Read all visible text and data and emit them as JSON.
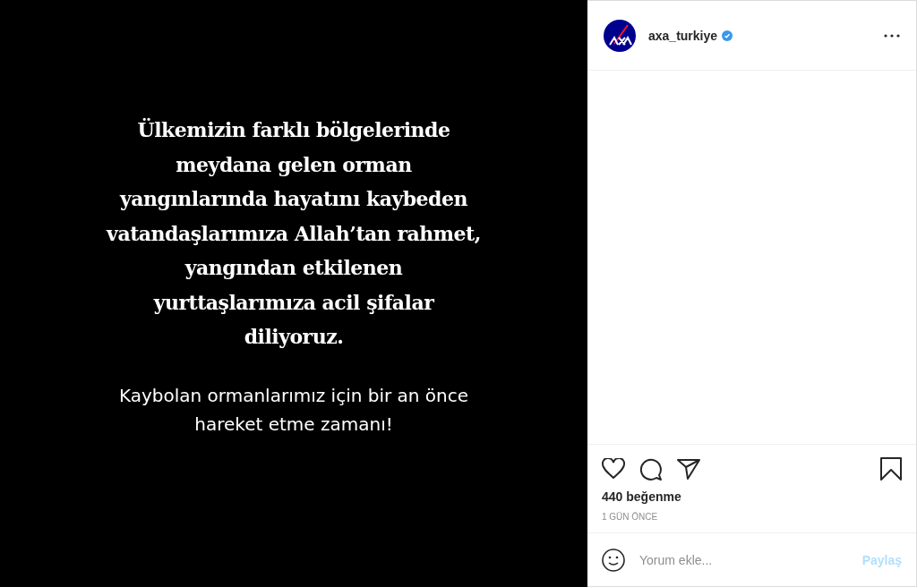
{
  "post_image": {
    "headline_lines": [
      "Ülkemizin farklı bölgelerinde",
      "meydana gelen orman",
      "yangınlarında hayatını kaybeden",
      "vatandaşlarımıza Allah’tan rahmet,",
      "yangından etkilenen",
      "yurttaşlarımıza acil şifalar",
      "diliyoruz."
    ],
    "subline_lines": [
      "Kaybolan ormanlarımız için bir an önce",
      "hareket etme zamanı!"
    ]
  },
  "header": {
    "username": "axa_turkiye",
    "verified": true
  },
  "likes": "440 beğenme",
  "time": "1 GÜN ÖNCE",
  "comment": {
    "placeholder": "Yorum ekle...",
    "submit": "Paylaş",
    "submit_disabled": true
  }
}
